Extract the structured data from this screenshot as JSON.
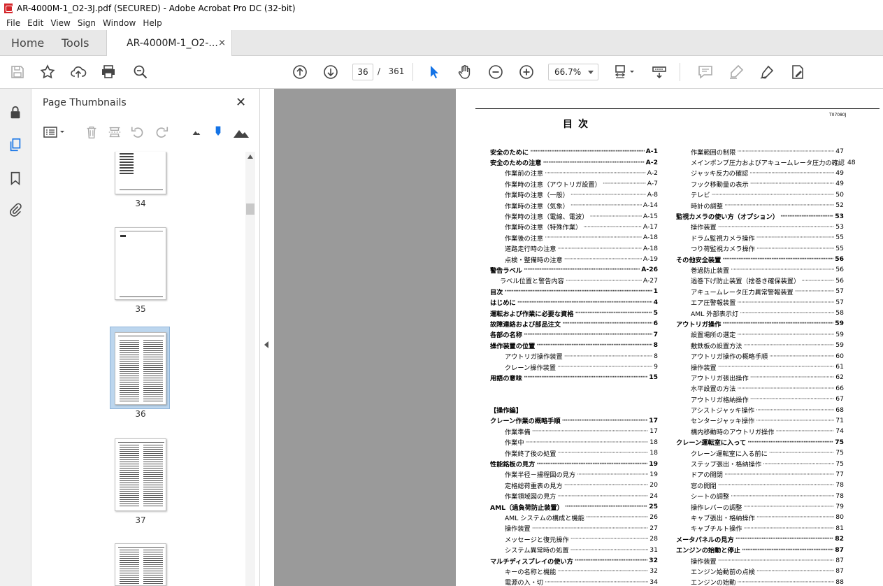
{
  "window": {
    "title": "AR-4000M-1_O2-3J.pdf (SECURED) - Adobe Acrobat Pro DC (32-bit)"
  },
  "menu": [
    "File",
    "Edit",
    "View",
    "Sign",
    "Window",
    "Help"
  ],
  "tabs": {
    "home": "Home",
    "tools": "Tools",
    "doc": "AR-4000M-1_O2-...",
    "close": "×"
  },
  "toolbar": {
    "page_current": "36",
    "page_sep": "/",
    "page_total": "361",
    "zoom": "66.7%"
  },
  "panel": {
    "title": "Page Thumbnails",
    "close": "✕",
    "thumbnails": [
      {
        "label": "34"
      },
      {
        "label": "35"
      },
      {
        "label": "36",
        "selected": true
      },
      {
        "label": "37"
      }
    ]
  },
  "doc": {
    "code": "T07080J",
    "title": "目次",
    "left_column": [
      {
        "t": "安全のために",
        "p": "A-1",
        "style": "b"
      },
      {
        "t": "安全のための注意",
        "p": "A-2",
        "style": "b"
      },
      {
        "t": "作業前の注意",
        "p": "A-2",
        "style": "i1"
      },
      {
        "t": "作業時の注意（アウトリガ設置）",
        "p": "A-7",
        "style": "i1"
      },
      {
        "t": "作業時の注意（一般）",
        "p": "A-8",
        "style": "i1"
      },
      {
        "t": "作業時の注意（気象）",
        "p": "A-14",
        "style": "i1"
      },
      {
        "t": "作業時の注意（電線、電波）",
        "p": "A-15",
        "style": "i1"
      },
      {
        "t": "作業時の注意（特殊作業）",
        "p": "A-17",
        "style": "i1"
      },
      {
        "t": "作業後の注意",
        "p": "A-18",
        "style": "i1"
      },
      {
        "t": "道路走行時の注意",
        "p": "A-18",
        "style": "i1"
      },
      {
        "t": "点検・整備時の注意",
        "p": "A-19",
        "style": "i1"
      },
      {
        "t": "警告ラベル",
        "p": "A-26",
        "style": "b"
      },
      {
        "t": "ラベル位置と警告内容",
        "p": "A-27",
        "style": "i2"
      },
      {
        "t": "目次",
        "p": "1",
        "style": "b"
      },
      {
        "t": "はじめに",
        "p": "4",
        "style": "b"
      },
      {
        "t": "運転および作業に必要な資格",
        "p": "5",
        "style": "b"
      },
      {
        "t": "故障連絡および部品注文",
        "p": "6",
        "style": "b"
      },
      {
        "t": "各部の名称",
        "p": "7",
        "style": "b"
      },
      {
        "t": "操作装置の位置",
        "p": "8",
        "style": "b"
      },
      {
        "t": "アウトリガ操作装置",
        "p": "8",
        "style": "i1"
      },
      {
        "t": "クレーン操作装置",
        "p": "9",
        "style": "i1"
      },
      {
        "t": "用語の意味",
        "p": "15",
        "style": "b"
      },
      {
        "t": "",
        "p": "",
        "style": "gap"
      },
      {
        "t": "",
        "p": "",
        "style": "gap"
      },
      {
        "t": "【操作編】",
        "p": "",
        "style": "section"
      },
      {
        "t": "クレーン作業の概略手順",
        "p": "17",
        "style": "b"
      },
      {
        "t": "作業準備",
        "p": "17",
        "style": "i1"
      },
      {
        "t": "作業中",
        "p": "18",
        "style": "i1"
      },
      {
        "t": "作業終了後の処置",
        "p": "18",
        "style": "i1"
      },
      {
        "t": "性能銘板の見方",
        "p": "19",
        "style": "b"
      },
      {
        "t": "作業半径－揚程図の見方",
        "p": "19",
        "style": "i1"
      },
      {
        "t": "定格総荷重表の見方",
        "p": "20",
        "style": "i1"
      },
      {
        "t": "作業領域図の見方",
        "p": "24",
        "style": "i1"
      },
      {
        "t": "AML（過負荷防止装置）",
        "p": "25",
        "style": "b"
      },
      {
        "t": "AML システムの構成と機能",
        "p": "26",
        "style": "i1"
      },
      {
        "t": "操作装置",
        "p": "27",
        "style": "i1"
      },
      {
        "t": "メッセージと復元操作",
        "p": "28",
        "style": "i1"
      },
      {
        "t": "システム異常時の処置",
        "p": "31",
        "style": "i1"
      },
      {
        "t": "マルチディスプレイの使い方",
        "p": "32",
        "style": "b"
      },
      {
        "t": "キーの名称と機能",
        "p": "32",
        "style": "i1"
      },
      {
        "t": "電源の入・切",
        "p": "34",
        "style": "i1"
      }
    ],
    "right_column": [
      {
        "t": "作業範囲の制限",
        "p": "47",
        "style": "i1"
      },
      {
        "t": "メインポンプ圧力およびアキュームレータ圧力の確認",
        "p": "48",
        "style": "i1"
      },
      {
        "t": "ジャッキ反力の確認",
        "p": "49",
        "style": "i1"
      },
      {
        "t": "フック移動量の表示",
        "p": "49",
        "style": "i1"
      },
      {
        "t": "テレビ",
        "p": "50",
        "style": "i1"
      },
      {
        "t": "時計の調整",
        "p": "52",
        "style": "i1"
      },
      {
        "t": "監視カメラの使い方（オプション）",
        "p": "53",
        "style": "b"
      },
      {
        "t": "操作装置",
        "p": "53",
        "style": "i1"
      },
      {
        "t": "ドラム監視カメラ操作",
        "p": "55",
        "style": "i1"
      },
      {
        "t": "つり荷監視カメラ操作",
        "p": "55",
        "style": "i1"
      },
      {
        "t": "その他安全装置",
        "p": "56",
        "style": "b"
      },
      {
        "t": "巻過防止装置",
        "p": "56",
        "style": "i1"
      },
      {
        "t": "過巻下げ防止装置（捨巻き確保装置）",
        "p": "56",
        "style": "i1"
      },
      {
        "t": "アキュームレータ圧力異常警報装置",
        "p": "57",
        "style": "i1"
      },
      {
        "t": "エア圧警報装置",
        "p": "57",
        "style": "i1"
      },
      {
        "t": "AML 外部表示灯",
        "p": "58",
        "style": "i1"
      },
      {
        "t": "アウトリガ操作",
        "p": "59",
        "style": "b"
      },
      {
        "t": "設置場所の選定",
        "p": "59",
        "style": "i1"
      },
      {
        "t": "敷鉄板の設置方法",
        "p": "59",
        "style": "i1"
      },
      {
        "t": "アウトリガ操作の概略手順",
        "p": "60",
        "style": "i1"
      },
      {
        "t": "操作装置",
        "p": "61",
        "style": "i1"
      },
      {
        "t": "アウトリガ張出操作",
        "p": "62",
        "style": "i1"
      },
      {
        "t": "水平設置の方法",
        "p": "66",
        "style": "i1"
      },
      {
        "t": "アウトリガ格納操作",
        "p": "67",
        "style": "i1"
      },
      {
        "t": "アシストジャッキ操作",
        "p": "68",
        "style": "i1"
      },
      {
        "t": "センタージャッキ操作",
        "p": "71",
        "style": "i1"
      },
      {
        "t": "構内移動時のアウトリガ操作",
        "p": "74",
        "style": "i1"
      },
      {
        "t": "クレーン運転室に入って",
        "p": "75",
        "style": "b"
      },
      {
        "t": "クレーン運転室に入る前に",
        "p": "75",
        "style": "i1"
      },
      {
        "t": "ステップ張出・格納操作",
        "p": "75",
        "style": "i1"
      },
      {
        "t": "ドアの開閉",
        "p": "77",
        "style": "i1"
      },
      {
        "t": "窓の開閉",
        "p": "78",
        "style": "i1"
      },
      {
        "t": "シートの調整",
        "p": "78",
        "style": "i1"
      },
      {
        "t": "操作レバーの調整",
        "p": "79",
        "style": "i1"
      },
      {
        "t": "キャブ張出・格納操作",
        "p": "80",
        "style": "i1"
      },
      {
        "t": "キャブチルト操作",
        "p": "81",
        "style": "i1"
      },
      {
        "t": "メータパネルの見方",
        "p": "82",
        "style": "b"
      },
      {
        "t": "エンジンの始動と停止",
        "p": "87",
        "style": "b"
      },
      {
        "t": "操作装置",
        "p": "87",
        "style": "i1"
      },
      {
        "t": "エンジン始動前の点検",
        "p": "87",
        "style": "i1"
      },
      {
        "t": "エンジンの始動",
        "p": "88",
        "style": "i1"
      }
    ]
  }
}
